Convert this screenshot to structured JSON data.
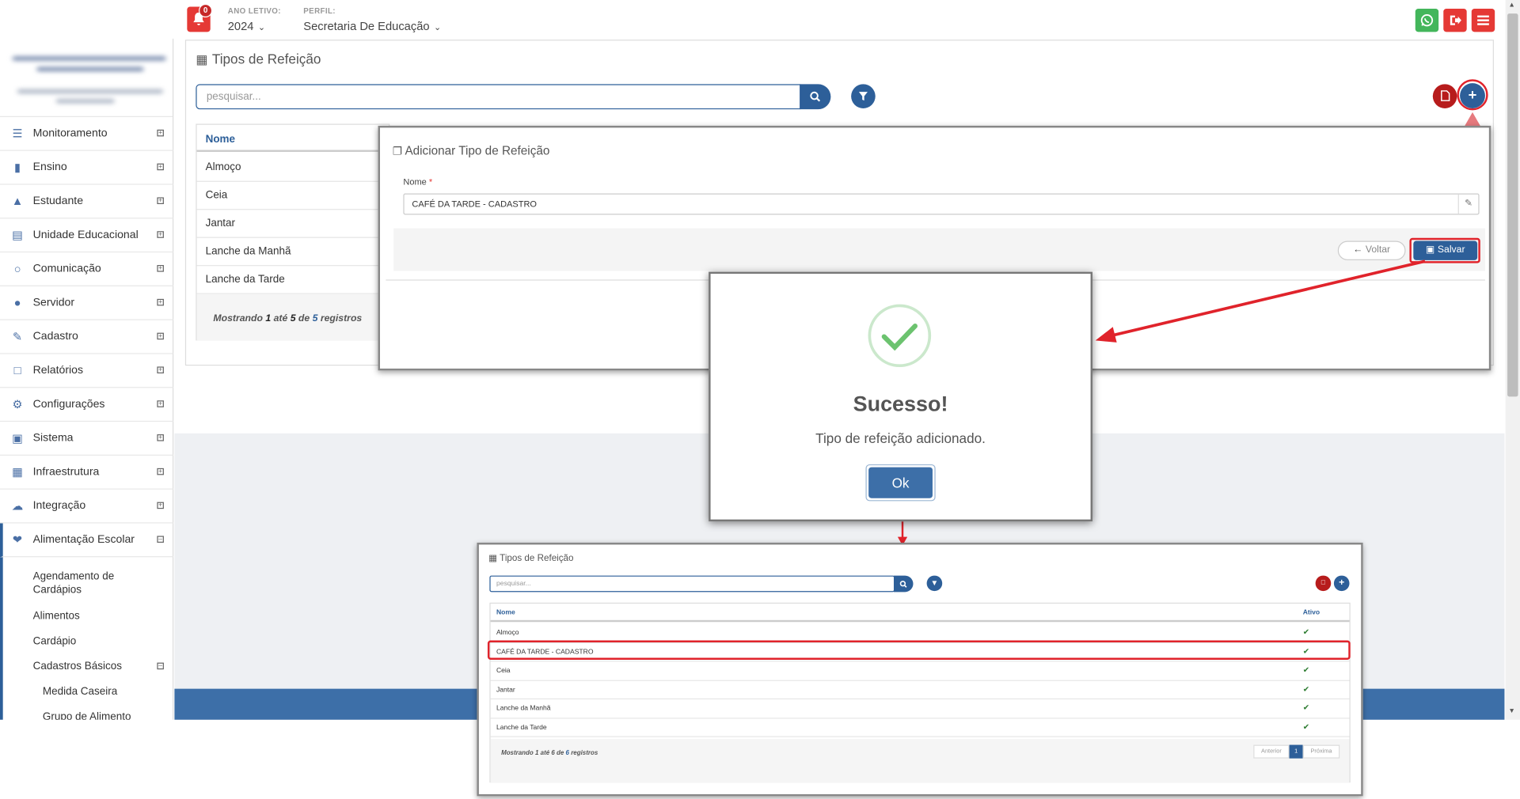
{
  "topbar": {
    "notification_count": "0",
    "year_label": "ANO LETIVO:",
    "year_value": "2024",
    "profile_label": "PERFIL:",
    "profile_value": "Secretaria De Educação"
  },
  "sidebar": {
    "items": [
      {
        "label": "Monitoramento",
        "icon": "sliders-icon"
      },
      {
        "label": "Ensino",
        "icon": "book-icon"
      },
      {
        "label": "Estudante",
        "icon": "graduation-cap-icon"
      },
      {
        "label": "Unidade Educacional",
        "icon": "institution-icon"
      },
      {
        "label": "Comunicação",
        "icon": "chat-bubble-icon"
      },
      {
        "label": "Servidor",
        "icon": "user-icon"
      },
      {
        "label": "Cadastro",
        "icon": "edit-icon"
      },
      {
        "label": "Relatórios",
        "icon": "file-icon"
      },
      {
        "label": "Configurações",
        "icon": "gear-icon"
      },
      {
        "label": "Sistema",
        "icon": "monitor-icon"
      },
      {
        "label": "Infraestrutura",
        "icon": "building-icon"
      },
      {
        "label": "Integração",
        "icon": "cloud-icon"
      },
      {
        "label": "Alimentação Escolar",
        "icon": "cutlery-icon"
      }
    ],
    "sub_items": [
      "Agendamento de Cardápios",
      "Alimentos",
      "Cardápio",
      "Cadastros Básicos"
    ],
    "sub_sub_items": [
      "Medida Caseira",
      "Grupo de Alimento"
    ]
  },
  "panel": {
    "title": "Tipos de Refeição",
    "search_placeholder": "pesquisar...",
    "table_header": "Nome",
    "rows": [
      "Almoço",
      "Ceia",
      "Jantar",
      "Lanche da Manhã",
      "Lanche da Tarde"
    ],
    "footer": {
      "prefix": "Mostrando",
      "from": "1",
      "to_word": "até",
      "to": "5",
      "of_word": "de",
      "total": "5",
      "suffix": "registros"
    }
  },
  "add_dialog": {
    "title": "Adicionar Tipo de Refeição",
    "field_label": "Nome",
    "required_mark": "*",
    "field_value": "CAFÉ DA TARDE - CADASTRO",
    "back_label": "Voltar",
    "save_label": "Salvar"
  },
  "success": {
    "title": "Sucesso!",
    "message": "Tipo de refeição adicionado.",
    "ok_label": "Ok"
  },
  "mini": {
    "title": "Tipos de Refeição",
    "search_placeholder": "pesquisar...",
    "col_name": "Nome",
    "col_active": "Ativo",
    "rows": [
      "Almoço",
      "CAFÉ DA TARDE - CADASTRO",
      "Ceia",
      "Jantar",
      "Lanche da Manhã",
      "Lanche da Tarde"
    ],
    "footer": {
      "prefix": "Mostrando",
      "from": "1",
      "to_word": "até",
      "to": "6",
      "of_word": "de",
      "total": "6",
      "suffix": "registros"
    },
    "pager": {
      "prev": "Anterior",
      "page": "1",
      "next": "Próxima"
    }
  },
  "colors": {
    "primary": "#2d5f99",
    "danger": "#e53935",
    "success": "#4caf50",
    "highlight": "#e0232b"
  }
}
